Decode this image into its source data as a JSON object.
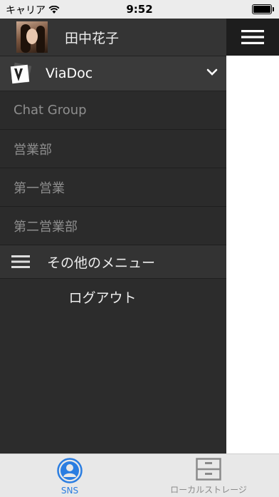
{
  "status_bar": {
    "carrier": "キャリア",
    "time": "9:52"
  },
  "profile": {
    "name": "田中花子"
  },
  "brand": {
    "title": "ViaDoc"
  },
  "groups": [
    {
      "label": "Chat Group"
    },
    {
      "label": "営業部"
    },
    {
      "label": "第一営業"
    },
    {
      "label": "第二営業部"
    }
  ],
  "other_menu": {
    "label": "その他のメニュー"
  },
  "logout": {
    "label": "ログアウト"
  },
  "tabs": [
    {
      "label": "SNS",
      "icon": "person-circle-icon",
      "active": true
    },
    {
      "label": "ローカルストレージ",
      "icon": "cabinet-icon",
      "active": false
    }
  ],
  "colors": {
    "active_tab": "#2a7de1",
    "sidebar_bg": "#2c2c2c",
    "topbar_bg": "#1d1d1d"
  }
}
